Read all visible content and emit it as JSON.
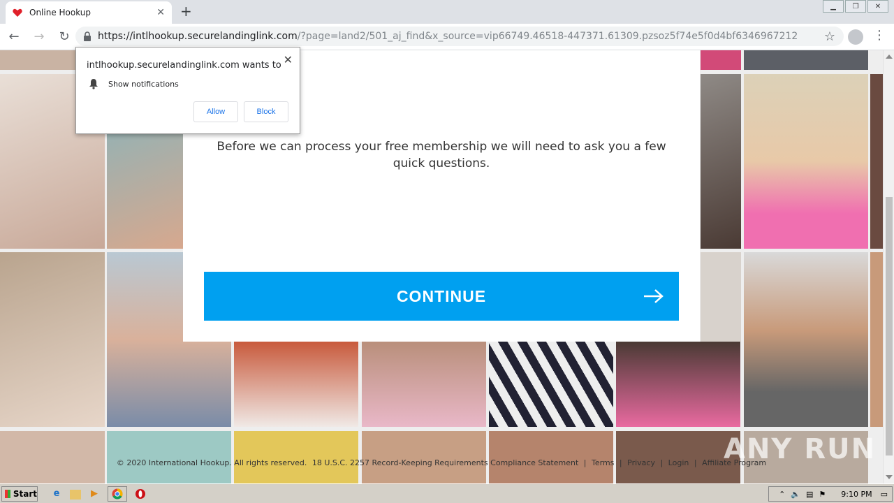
{
  "browser": {
    "tab_title": "Online Hookup",
    "url_host": "https://intlhookup.securelandinglink.com",
    "url_rest": "/?page=land2/501_aj_find&x_source=vip66749.46518-447371.61309.pzsoz5f74e5f0d4bf6346967212"
  },
  "notification": {
    "title": "intlhookup.securelandinglink.com wants to",
    "permission": "Show notifications",
    "allow_label": "Allow",
    "block_label": "Block"
  },
  "modal": {
    "text": "Before we can process your free membership we will need to ask you a few quick questions.",
    "continue_label": "CONTINUE"
  },
  "footer": {
    "copyright": "© 2020 International Hookup. All rights reserved.",
    "usc": "18 U.S.C. 2257 Record-Keeping Requirements Compliance Statement",
    "terms": "Terms",
    "privacy": "Privacy",
    "login": "Login",
    "affiliate": "Affiliate Program",
    "sep": "|"
  },
  "watermark": "ANY RUN",
  "taskbar": {
    "start_label": "Start",
    "clock": "9:10 PM"
  },
  "colors": {
    "accent": "#00a0f0"
  }
}
